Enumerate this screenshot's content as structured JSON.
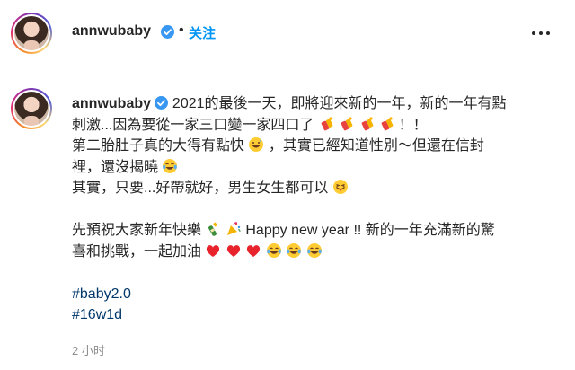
{
  "header": {
    "username": "annwubaby",
    "separator": "•",
    "follow_label": "关注"
  },
  "caption": {
    "username": "annwubaby",
    "line1_text": "2021的最後一天，即將迎來新的一年，新的一年有點",
    "line2_text": "刺激...因為要從一家三口變一家四口了",
    "line2_end": "！！",
    "line3_text": "第二胎肚子真的大得有點快",
    "line3_end": "，其實已經知道性別～但還在信封",
    "line4_text": "裡，還沒揭曉",
    "line5_text": "其實，只要...好帶就好，男生女生都可以",
    "line6_text": "先預祝大家新年快樂",
    "line6_end": "Happy new year !! 新的一年充滿新的驚",
    "line7_text": "喜和挑戰，一起加油",
    "hashtags": [
      "#baby2.0",
      "#16w1d"
    ]
  },
  "emojis": {
    "line2": [
      "firecracker-emoji",
      "firecracker-emoji",
      "firecracker-emoji",
      "firecracker-emoji"
    ],
    "line3": [
      "grin-sweat-emoji"
    ],
    "line4": [
      "tears-of-joy-emoji"
    ],
    "line5": [
      "tongue-wink-emoji"
    ],
    "line6": [
      "champagne-emoji",
      "party-popper-emoji"
    ],
    "line7": [
      "red-heart-emoji",
      "red-heart-emoji",
      "red-heart-emoji",
      "tears-of-joy-emoji",
      "tears-of-joy-emoji",
      "tears-of-joy-emoji"
    ]
  },
  "timestamp": "2 小时",
  "colors": {
    "accent": "#0095f6",
    "verified": "#3897f0",
    "hashtag": "#00376b",
    "muted": "#8e8e8e"
  }
}
